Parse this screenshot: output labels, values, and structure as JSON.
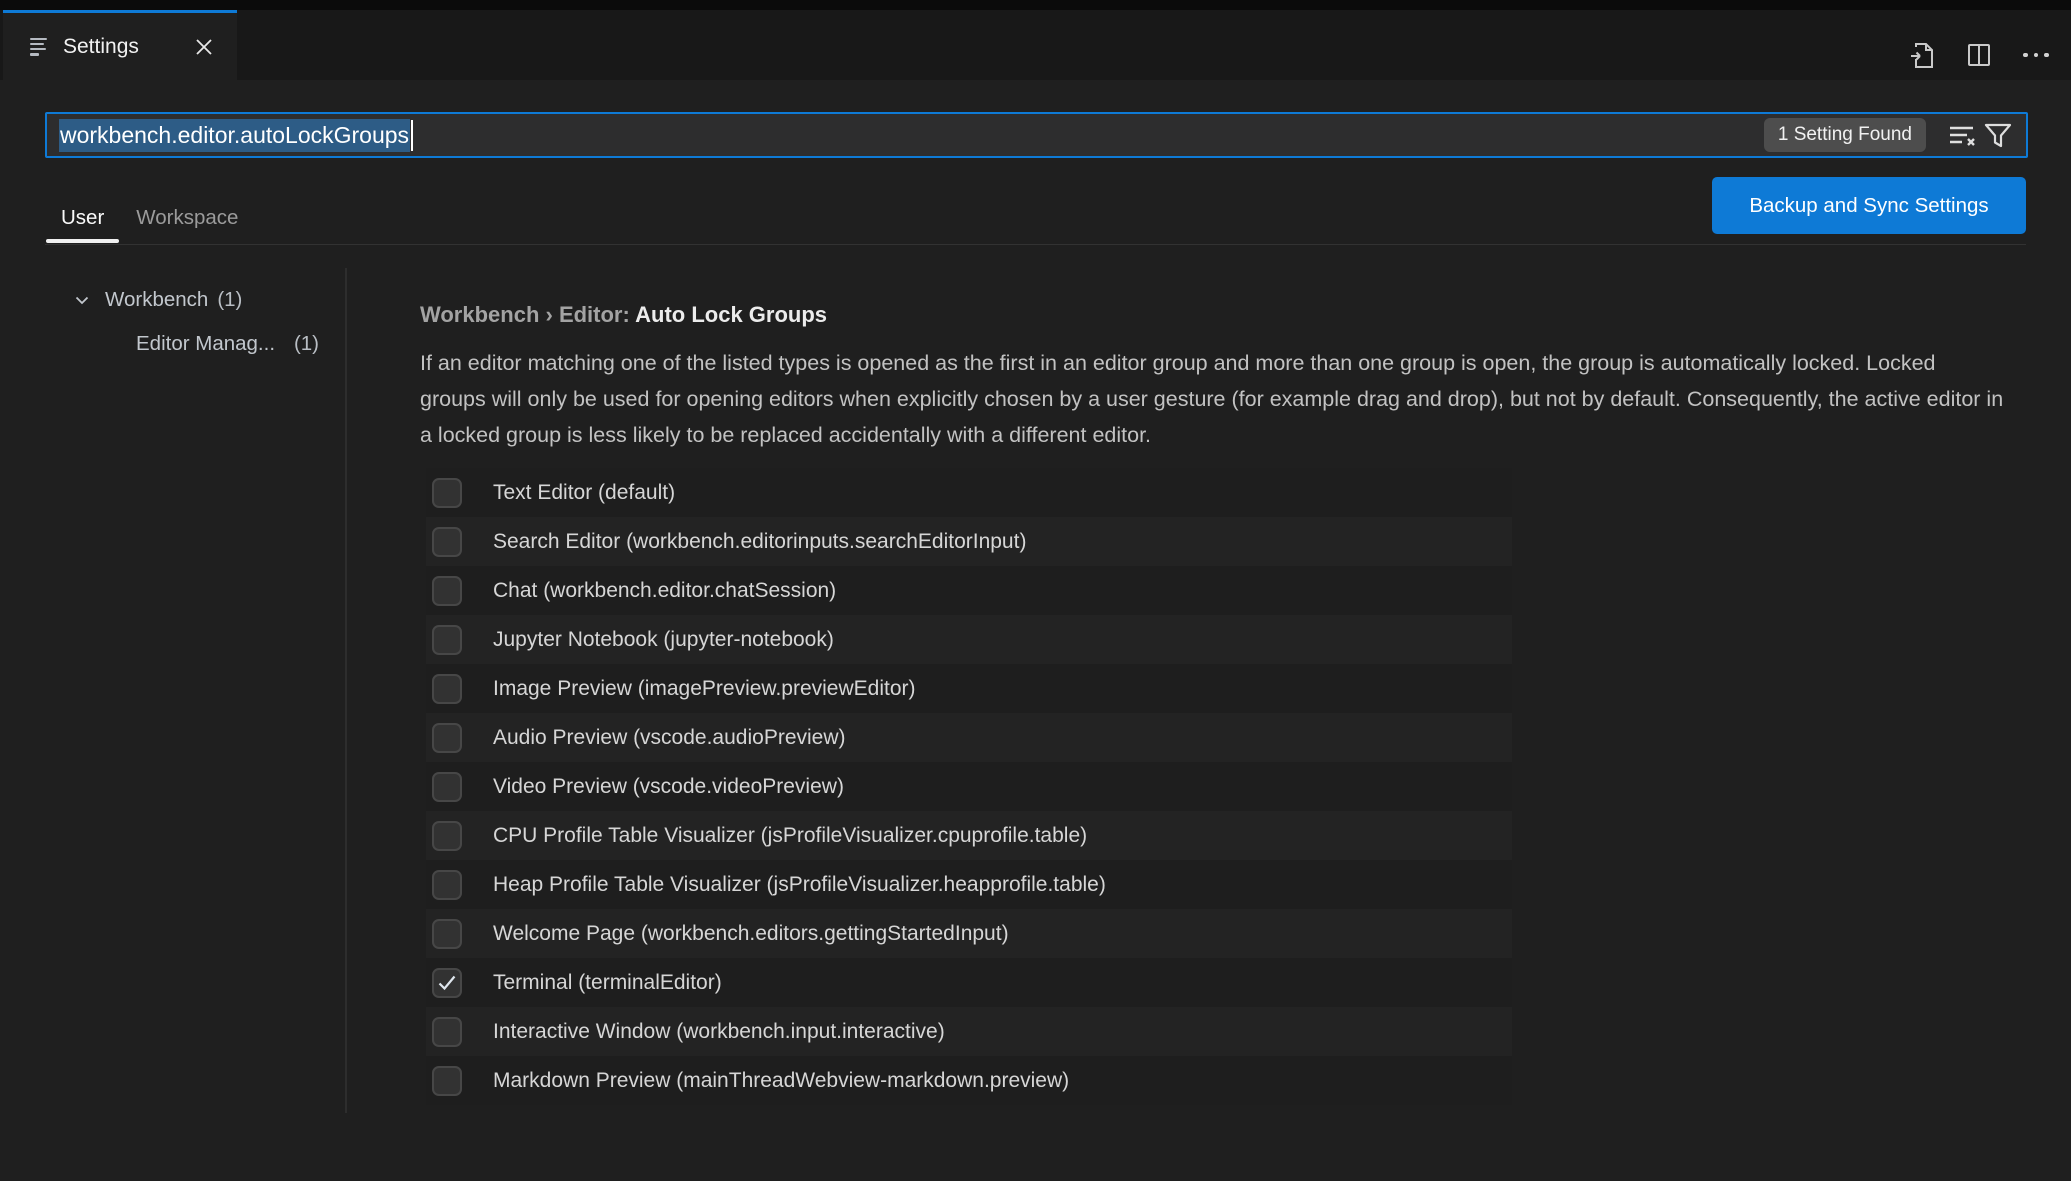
{
  "tab": {
    "label": "Settings"
  },
  "search": {
    "value": "workbench.editor.autoLockGroups",
    "results_badge": "1 Setting Found"
  },
  "scope_tabs": {
    "user": "User",
    "workspace": "Workspace"
  },
  "backup_button_label": "Backup and Sync Settings",
  "toc": {
    "items": {
      "0": {
        "label": "Workbench",
        "count": "(1)"
      },
      "1": {
        "label": "Editor Manag...",
        "count": "(1)"
      }
    }
  },
  "setting": {
    "breadcrumb": "Workbench › Editor: ",
    "title": "Auto Lock Groups",
    "description": "If an editor matching one of the listed types is opened as the first in an editor group and more than one group is open, the group is automatically locked. Locked groups will only be used for opening editors when explicitly chosen by a user gesture (for example drag and drop), but not by default. Consequently, the active editor in a locked group is less likely to be replaced accidentally with a different editor.",
    "options": [
      {
        "label": "Text Editor (default)",
        "checked": false
      },
      {
        "label": "Search Editor (workbench.editorinputs.searchEditorInput)",
        "checked": false
      },
      {
        "label": "Chat (workbench.editor.chatSession)",
        "checked": false
      },
      {
        "label": "Jupyter Notebook (jupyter-notebook)",
        "checked": false
      },
      {
        "label": "Image Preview (imagePreview.previewEditor)",
        "checked": false
      },
      {
        "label": "Audio Preview (vscode.audioPreview)",
        "checked": false
      },
      {
        "label": "Video Preview (vscode.videoPreview)",
        "checked": false
      },
      {
        "label": "CPU Profile Table Visualizer (jsProfileVisualizer.cpuprofile.table)",
        "checked": false
      },
      {
        "label": "Heap Profile Table Visualizer (jsProfileVisualizer.heapprofile.table)",
        "checked": false
      },
      {
        "label": "Welcome Page (workbench.editors.gettingStartedInput)",
        "checked": false
      },
      {
        "label": "Terminal (terminalEditor)",
        "checked": true
      },
      {
        "label": "Interactive Window (workbench.input.interactive)",
        "checked": false
      },
      {
        "label": "Markdown Preview (mainThreadWebview-markdown.preview)",
        "checked": false
      }
    ]
  },
  "colors": {
    "accent": "#0e7ad6",
    "selection": "#2d5c86",
    "badge_bg": "#4d4d4d",
    "page_bg": "#1f1f1f",
    "tabbar_bg": "#181818"
  },
  "icons": {
    "tab": "settings-list-icon",
    "close": "close-icon",
    "open_json": "go-to-file-icon",
    "split": "split-editor-icon",
    "more": "ellipsis-icon",
    "clear": "clear-filter-icon",
    "filter": "funnel-icon",
    "chevron": "chevron-down-icon",
    "check": "checkmark-icon"
  }
}
